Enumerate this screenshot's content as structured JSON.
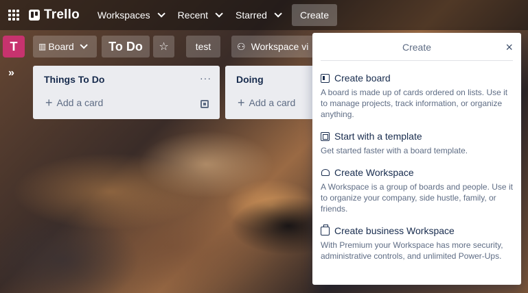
{
  "topnav": {
    "logo": "Trello",
    "items": [
      {
        "label": "Workspaces"
      },
      {
        "label": "Recent"
      },
      {
        "label": "Starred"
      }
    ],
    "create_label": "Create"
  },
  "board": {
    "avatar_letter": "T",
    "view_label": "Board",
    "title": "To Do",
    "tag": "test",
    "workspace_label": "Workspace vi"
  },
  "lists": [
    {
      "title": "Things To Do",
      "menu": "···",
      "add_label": "Add a card"
    },
    {
      "title": "Doing",
      "add_label": "Add a card"
    }
  ],
  "popover": {
    "title": "Create",
    "close": "×",
    "options": [
      {
        "title": "Create board",
        "icon": "board-icon",
        "desc": "A board is made up of cards ordered on lists. Use it to manage projects, track information, or organize anything."
      },
      {
        "title": "Start with a template",
        "icon": "template-icon",
        "desc": "Get started faster with a board template."
      },
      {
        "title": "Create Workspace",
        "icon": "workspace-icon",
        "desc": "A Workspace is a group of boards and people. Use it to organize your company, side hustle, family, or friends."
      },
      {
        "title": "Create business Workspace",
        "icon": "business-icon",
        "desc": "With Premium your Workspace has more security, administrative controls, and unlimited Power-Ups."
      }
    ]
  }
}
